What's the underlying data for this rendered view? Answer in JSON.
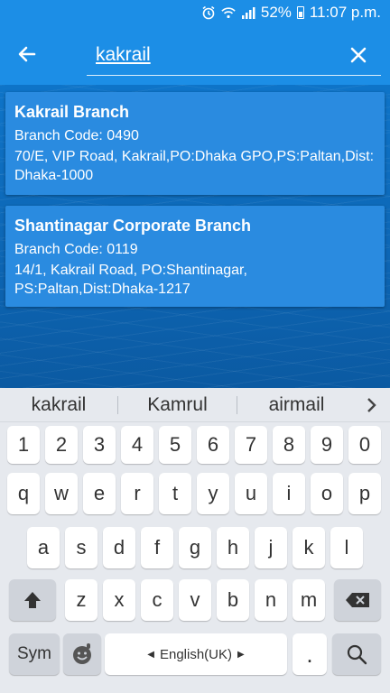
{
  "status_bar": {
    "icons": [
      "alarm-icon",
      "wifi-icon",
      "signal-icon",
      "battery-icon"
    ],
    "battery_percent": "52%",
    "time": "11:07 p.m."
  },
  "app_bar": {
    "back_icon": "arrow-left-icon",
    "search_value": "kakrail",
    "clear_icon": "close-icon"
  },
  "results": [
    {
      "name": "Kakrail Branch",
      "code": "Branch Code: 0490",
      "address": "70/E, VIP Road, Kakrail,PO:Dhaka GPO,PS:Paltan,Dist: Dhaka-1000"
    },
    {
      "name": "Shantinagar Corporate Branch",
      "code": "Branch Code: 0119",
      "address": "14/1, Kakrail Road, PO:Shantinagar, PS:Paltan,Dist:Dhaka-1217"
    }
  ],
  "keyboard": {
    "suggestions": [
      "kakrail",
      "Kamrul",
      "airmail"
    ],
    "row_numbers": [
      "1",
      "2",
      "3",
      "4",
      "5",
      "6",
      "7",
      "8",
      "9",
      "0"
    ],
    "row_q": [
      "q",
      "w",
      "e",
      "r",
      "t",
      "y",
      "u",
      "i",
      "o",
      "p"
    ],
    "row_a": [
      "a",
      "s",
      "d",
      "f",
      "g",
      "h",
      "j",
      "k",
      "l"
    ],
    "row_z": [
      "z",
      "x",
      "c",
      "v",
      "b",
      "n",
      "m"
    ],
    "sym_label": "Sym",
    "space_label": "English(UK)",
    "period_label": "."
  },
  "colors": {
    "app_bar": "#1c8ee6",
    "card": "#2a8be0",
    "background": "#0d66b4",
    "keyboard": "#e6e9ee"
  }
}
